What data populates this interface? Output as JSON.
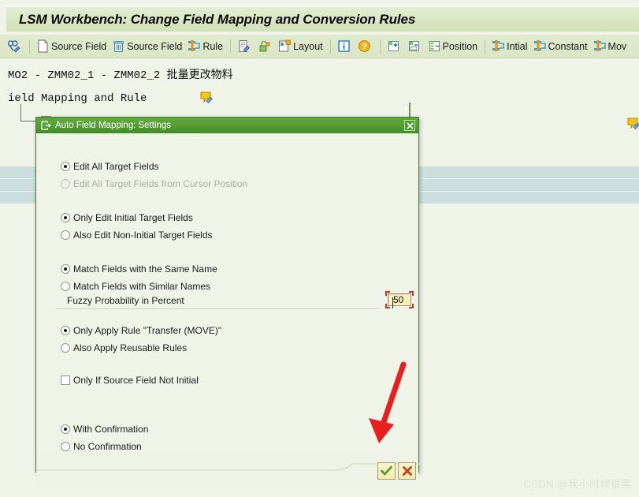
{
  "window": {
    "title": "LSM Workbench: Change Field Mapping and Conversion Rules"
  },
  "toolbar": {
    "items": [
      {
        "label": "",
        "icon": "binoculars-pencil-icon"
      },
      {
        "label": "Source Field",
        "icon": "new-document-icon"
      },
      {
        "label": "Source Field",
        "icon": "trash-delete-icon"
      },
      {
        "label": "Rule",
        "icon": "rule-transfer-icon"
      },
      {
        "label": "",
        "icon": "edit-note-icon"
      },
      {
        "label": "",
        "icon": "lock-unlock-icon"
      },
      {
        "label": "Layout",
        "icon": "layout-icon"
      },
      {
        "label": "",
        "icon": "information-icon"
      },
      {
        "label": "",
        "icon": "help-question-icon"
      },
      {
        "label": "",
        "icon": "expand-all-icon"
      },
      {
        "label": "",
        "icon": "collapse-all-icon"
      },
      {
        "label": "Position",
        "icon": "position-icon"
      },
      {
        "label": "Intial",
        "icon": "rule-initial-icon"
      },
      {
        "label": "Constant",
        "icon": "rule-constant-icon"
      },
      {
        "label": "Mov",
        "icon": "rule-move-icon"
      }
    ]
  },
  "background": {
    "object_line": "MO2 - ZMM02_1 - ZMM02_2 批量更改物料",
    "section_line": "ield Mapping and Rule"
  },
  "dialog": {
    "title": "Auto Field Mapping: Settings",
    "close_label": "x",
    "groups": [
      {
        "name": "scope",
        "options": [
          {
            "label": "Edit All Target Fields",
            "checked": true,
            "disabled": false
          },
          {
            "label": "Edit All Target Fields from Cursor Position",
            "checked": false,
            "disabled": true
          }
        ]
      },
      {
        "name": "target-fields",
        "options": [
          {
            "label": "Only Edit Initial Target Fields",
            "checked": true,
            "disabled": false
          },
          {
            "label": "Also Edit Non-Initial Target Fields",
            "checked": false,
            "disabled": false
          }
        ]
      },
      {
        "name": "matching",
        "options": [
          {
            "label": "Match Fields with the Same Name",
            "checked": true,
            "disabled": false
          },
          {
            "label": "Match Fields with Similar Names",
            "checked": false,
            "disabled": false
          }
        ]
      },
      {
        "name": "rules",
        "options": [
          {
            "label": "Only Apply Rule \"Transfer (MOVE)\"",
            "checked": true,
            "disabled": false
          },
          {
            "label": "Also Apply Reusable Rules",
            "checked": false,
            "disabled": false
          }
        ]
      },
      {
        "name": "confirmation",
        "options": [
          {
            "label": "With Confirmation",
            "checked": true,
            "disabled": false
          },
          {
            "label": "No Confirmation",
            "checked": false,
            "disabled": false
          }
        ]
      }
    ],
    "fuzzy": {
      "label": "Fuzzy Probability in Percent",
      "value": "50",
      "placeholder": ""
    },
    "checkbox": {
      "label": "Only If Source Field Not Initial",
      "checked": false
    },
    "footer": {
      "confirm_label": "",
      "confirm_icon": "green-check-icon",
      "cancel_label": "",
      "cancel_icon": "red-cross-icon"
    }
  },
  "annotation": {
    "arrow_color": "#e81f1f"
  },
  "watermark": {
    "text": "CSDN @我小时候很黑"
  },
  "colors": {
    "banner_bg": "#d9e6c3",
    "toolbar_bg": "#dde9ca",
    "dialog_title_green": "#4e9c2e",
    "page_bg": "#f0f4e8",
    "table_blue": "#ccdede",
    "input_bg": "#fcf0ba",
    "focus_marker": "#d93025"
  }
}
